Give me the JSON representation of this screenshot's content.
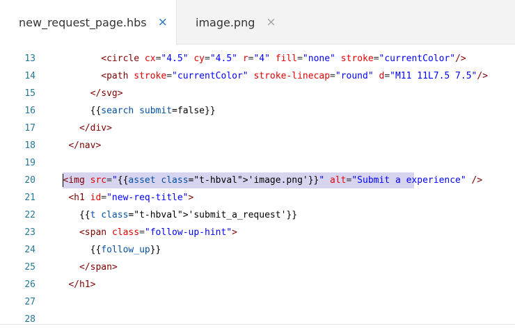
{
  "tabs": [
    {
      "label": "new_request_page.hbs",
      "close": "×",
      "active": true
    },
    {
      "label": "image.png",
      "close": "×",
      "active": false
    }
  ],
  "lines": [
    {
      "n": "13",
      "text": "          <circle cx=\"4.5\" cy=\"4.5\" r=\"4\" fill=\"none\" stroke=\"currentColor\"/>"
    },
    {
      "n": "14",
      "text": "          <path stroke=\"currentColor\" stroke-linecap=\"round\" d=\"M11 11L7.5 7.5\"/>"
    },
    {
      "n": "15",
      "text": "        </svg>"
    },
    {
      "n": "16",
      "text": "        {{search submit=false}}"
    },
    {
      "n": "17",
      "text": "      </div>"
    },
    {
      "n": "18",
      "text": "    </nav>"
    },
    {
      "n": "19",
      "text": ""
    },
    {
      "n": "20",
      "text": "   <img src=\"{{asset 'image.png'}}\" alt=\"Submit a experience\" />"
    },
    {
      "n": "21",
      "text": "    <h1 id=\"new-req-title\">"
    },
    {
      "n": "22",
      "text": "      {{t 'submit_a_request'}}"
    },
    {
      "n": "23",
      "text": "      <span class=\"follow-up-hint\">"
    },
    {
      "n": "24",
      "text": "        {{follow_up}}"
    },
    {
      "n": "25",
      "text": "      </span>"
    },
    {
      "n": "26",
      "text": "    </h1>"
    },
    {
      "n": "27",
      "text": ""
    },
    {
      "n": "28",
      "text": ""
    }
  ],
  "selected_line": "20",
  "colors": {
    "tag": "#800000",
    "attribute": "#e50000",
    "string": "#0000ff",
    "line_number": "#237893",
    "selection": "#d7d4f0",
    "active_close": "#1f6fb3"
  }
}
